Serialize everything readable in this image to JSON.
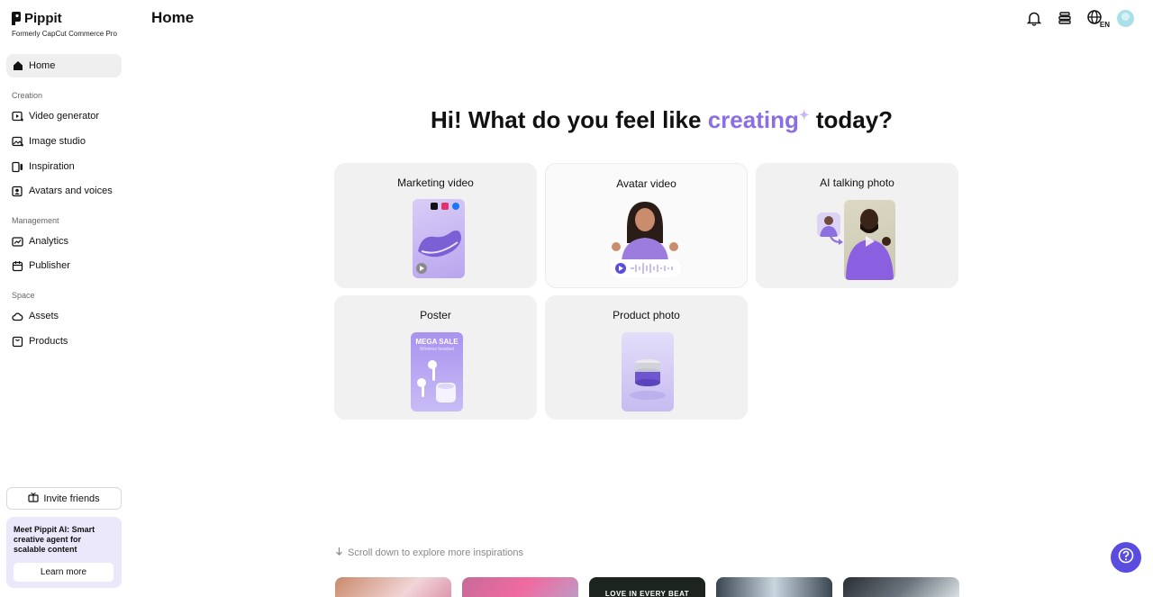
{
  "brand": {
    "name": "Pippit",
    "subtitle": "Formerly CapCut Commerce Pro"
  },
  "header": {
    "title": "Home",
    "lang": "EN"
  },
  "sidebar": {
    "home": "Home",
    "creation_label": "Creation",
    "creation": [
      "Video generator",
      "Image studio",
      "Inspiration",
      "Avatars and voices"
    ],
    "management_label": "Management",
    "management": [
      "Analytics",
      "Publisher"
    ],
    "space_label": "Space",
    "space": [
      "Assets",
      "Products"
    ],
    "invite": "Invite friends",
    "promo_text": "Meet Pippit AI: Smart creative agent for scalable content",
    "promo_button": "Learn more"
  },
  "hero": {
    "before": "Hi! What do you feel like ",
    "accent": "creating",
    "after": " today?"
  },
  "cards": {
    "marketing": "Marketing video",
    "avatar": "Avatar video",
    "talking": "AI talking photo",
    "poster": "Poster",
    "product": "Product photo",
    "poster_headline": "MEGA SALE",
    "poster_sub": "Wireless headset"
  },
  "scroll_hint": "Scroll down to explore more inspirations",
  "thumbs": {
    "t3": "LOVE IN EVERY BEAT"
  },
  "colors": {
    "accent": "#8b6ee6",
    "help": "#5b4ce0"
  }
}
